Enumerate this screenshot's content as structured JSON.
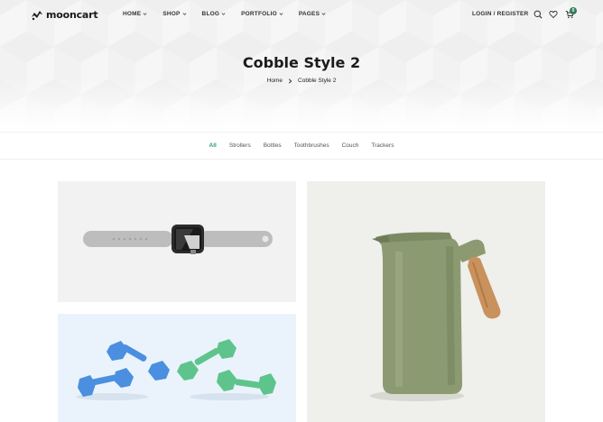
{
  "brand": {
    "name": "mooncart"
  },
  "nav": {
    "items": [
      {
        "label": "HOME"
      },
      {
        "label": "SHOP"
      },
      {
        "label": "BLOG"
      },
      {
        "label": "PORTFOLIO"
      },
      {
        "label": "PAGES"
      }
    ],
    "login_label": "LOGIN / REGISTER",
    "cart_count": "0"
  },
  "hero": {
    "title": "Cobble Style 2",
    "breadcrumb": [
      "Home",
      "Cobble Style 2"
    ]
  },
  "filters": {
    "items": [
      {
        "label": "All",
        "active": true
      },
      {
        "label": "Strollers"
      },
      {
        "label": "Bottles"
      },
      {
        "label": "Toothbrushes"
      },
      {
        "label": "Couch"
      },
      {
        "label": "Trackers"
      }
    ]
  },
  "products": [
    {
      "image": "smartwatch-grey-band"
    },
    {
      "image": "green-thermos-jug-wooden-handle"
    },
    {
      "image": "blue-and-green-dumbbells"
    }
  ],
  "colors": {
    "accent": "#2e9a6b",
    "text": "#222222",
    "hero_bg": "#f6f6f6"
  }
}
